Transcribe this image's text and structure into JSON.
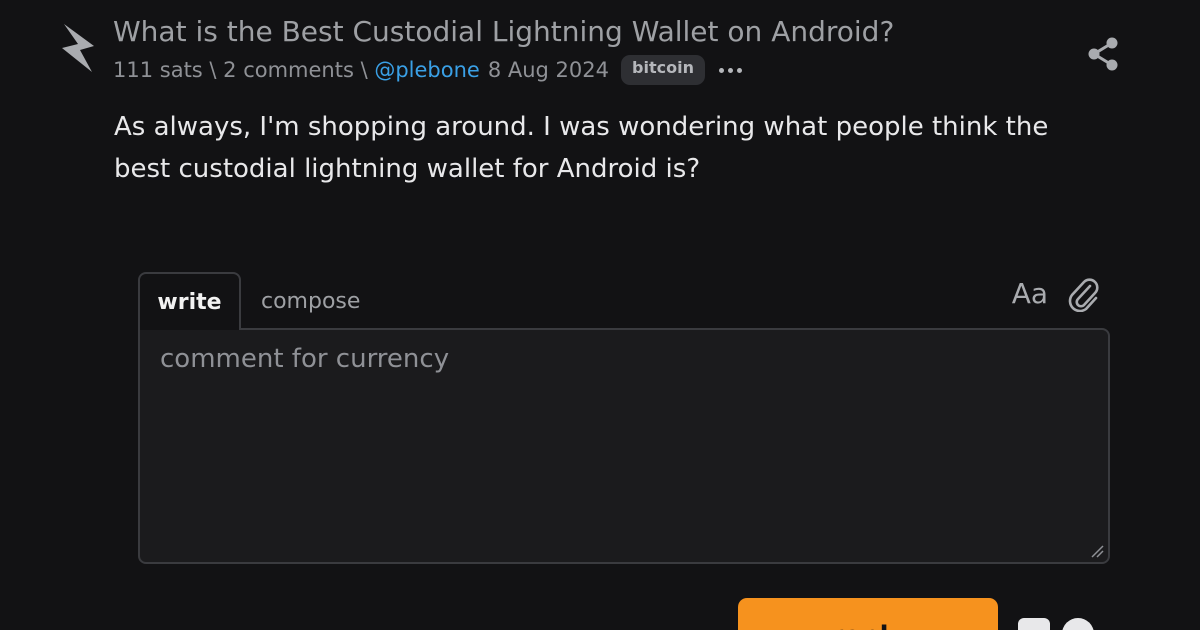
{
  "post": {
    "title": "What is the Best Custodial Lightning Wallet on Android?",
    "meta_prefix": "111 sats \\ 2 comments \\ ",
    "author": "@plebone",
    "date": "8 Aug 2024",
    "tag": "bitcoin",
    "body": "As always, I'm shopping around. I was wondering what people think the best custodial lightning wallet for Android is?"
  },
  "icons": {
    "upvote": "lightning-bolt-icon",
    "share": "share-icon",
    "more": "more-icon",
    "format": "text-format-icon",
    "attach": "paperclip-icon"
  },
  "editor": {
    "tab_write": "write",
    "tab_compose": "compose",
    "format_label": "Aa",
    "placeholder": "comment for currency"
  },
  "reply": {
    "label": "reply"
  },
  "colors": {
    "background": "#121214",
    "accent": "#f6921e",
    "link": "#3aa0e6"
  }
}
